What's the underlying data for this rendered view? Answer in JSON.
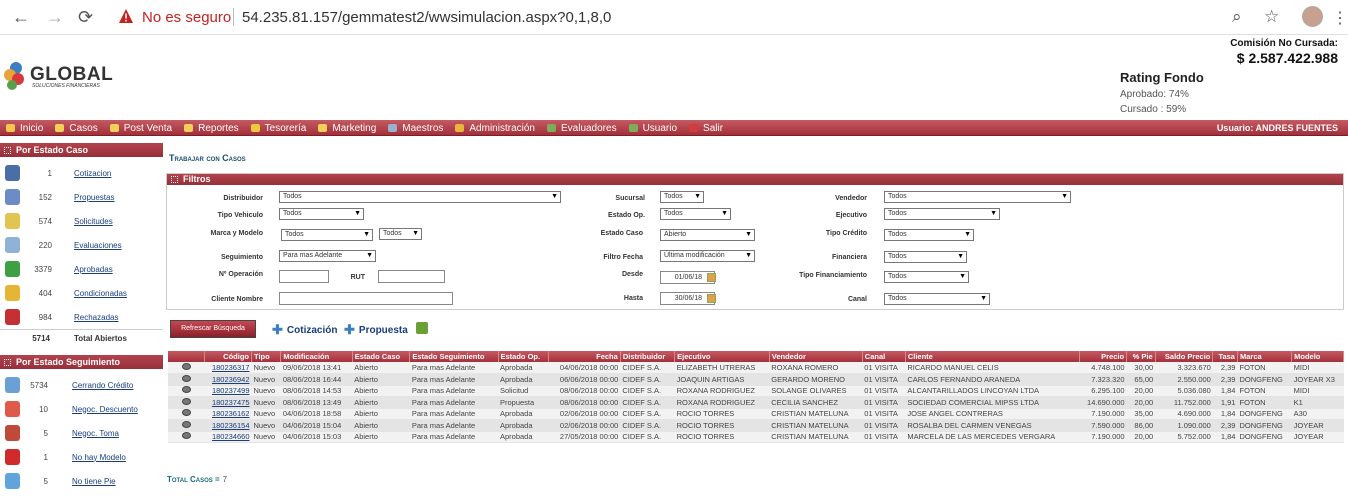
{
  "browser": {
    "back": "←",
    "forward": "→",
    "reload": "⟳",
    "security_label": "No es seguro",
    "url": "54.235.81.157/gemmatest2/wwsimulacion.aspx?0,1,8,0",
    "zoom_icon": "⌕",
    "star_icon": "☆",
    "kebab": "⋮"
  },
  "header": {
    "logo_text": "GLOBAL",
    "logo_sub": "SOLUCIONES FINANCIERAS",
    "comision_label": "Comisión No Cursada:",
    "comision_value": "$ 2.587.422.988",
    "rating_title": "Rating Fondo",
    "rating_aprobado": "Aprobado: 74%",
    "rating_cursado": "Cursado : 59%"
  },
  "menu": {
    "items": [
      {
        "label": "Inicio",
        "color": "#f3c64c"
      },
      {
        "label": "Casos",
        "color": "#f1d05a"
      },
      {
        "label": "Post Venta",
        "color": "#f1d05a"
      },
      {
        "label": "Reportes",
        "color": "#f1d05a"
      },
      {
        "label": "Tesorería",
        "color": "#ecc93d"
      },
      {
        "label": "Marketing",
        "color": "#f1d05a"
      },
      {
        "label": "Maestros",
        "color": "#9ab0cf"
      },
      {
        "label": "Administración",
        "color": "#e8b63b"
      },
      {
        "label": "Evaluadores",
        "color": "#7cae5a"
      },
      {
        "label": "Usuario",
        "color": "#7cae5a"
      },
      {
        "label": "Salir",
        "color": "#d33c3c"
      }
    ],
    "user": "Usuario:  ANDRES FUENTES"
  },
  "side_estado": {
    "title": "Por Estado Caso",
    "rows": [
      {
        "count": "1",
        "label": "Cotizacion",
        "color": "#4a6ea5"
      },
      {
        "count": "152",
        "label": "Propuestas",
        "color": "#6b8cc4"
      },
      {
        "count": "574",
        "label": "Solicitudes",
        "color": "#e1c550"
      },
      {
        "count": "220",
        "label": "Evaluaciones",
        "color": "#8eb3d6"
      },
      {
        "count": "3379",
        "label": "Aprobadas",
        "color": "#3ea044"
      },
      {
        "count": "404",
        "label": "Condicionadas",
        "color": "#e7b536"
      },
      {
        "count": "984",
        "label": "Rechazadas",
        "color": "#c53035"
      }
    ],
    "total_count": "5714",
    "total_label": "Total Abiertos"
  },
  "side_seguimiento": {
    "title": "Por Estado Seguimiento",
    "rows": [
      {
        "count": "5734",
        "label": "Cerrando Crédito",
        "color": "#6aa0d4"
      },
      {
        "count": "10",
        "label": "Negoc. Descuento",
        "color": "#e05a4a"
      },
      {
        "count": "5",
        "label": "Negoc. Toma",
        "color": "#c04a3a"
      },
      {
        "count": "1",
        "label": "No hay Modelo",
        "color": "#d02a2a"
      },
      {
        "count": "5",
        "label": "No tiene Pie",
        "color": "#5fa5dc"
      }
    ]
  },
  "main": {
    "title": "Trabajar con Casos"
  },
  "filtros": {
    "title": "Filtros",
    "distribuidor_label": "Distribuidor",
    "distribuidor": "Todos",
    "sucursal_label": "Sucursal",
    "sucursal": "Todos",
    "vendedor_label": "Vendedor",
    "vendedor": "Todos",
    "tipo_vehiculo_label": "Tipo Vehiculo",
    "tipo_vehiculo": "Todos",
    "estado_op_label": "Estado Op.",
    "estado_op": "Todos",
    "ejecutivo_label": "Ejecutivo",
    "ejecutivo": "Todos",
    "marca_modelo_label": "Marca y Modelo",
    "marca": "Todos",
    "modelo": "Todos",
    "estado_caso_label": "Estado Caso",
    "estado_caso": "Abierto",
    "tipo_credito_label": "Tipo Crédito",
    "tipo_credito": "Todos",
    "seguimiento_label": "Seguimiento",
    "seguimiento": "Para mas Adelante",
    "filtro_fecha_label": "Filtro Fecha",
    "filtro_fecha": "Última modificación",
    "financiera_label": "Financiera",
    "financiera": "Todos",
    "nro_operacion_label": "Nº Operación",
    "rut_label": "RUT",
    "desde_label": "Desde",
    "desde": "01/06/18",
    "tipo_financiamiento_label": "Tipo Financiamiento",
    "tipo_financiamiento": "Todos",
    "cliente_nombre_label": "Cliente Nombre",
    "hasta_label": "Hasta",
    "hasta": "30/06/18",
    "canal_label": "Canal",
    "canal": "Todos"
  },
  "actions": {
    "refresh": "Refrescar Búsqueda",
    "cotizacion": "Cotización",
    "propuesta": "Propuesta"
  },
  "grid": {
    "headers": [
      "Código",
      "Tipo",
      "Modificación",
      "Estado Caso",
      "Estado Seguimiento",
      "Estado Op.",
      "Fecha",
      "Distribuidor",
      "Ejecutivo",
      "Vendedor",
      "Canal",
      "Cliente",
      "Precio",
      "% Pie",
      "Saldo Precio",
      "Tasa",
      "Marca",
      "Modelo"
    ],
    "rows": [
      [
        "180236317",
        "Nuevo",
        "09/06/2018 13:41",
        "Abierto",
        "Para mas Adelante",
        "Aprobada",
        "04/06/2018 00:00",
        "CIDEF S.A.",
        "ELIZABETH UTRERAS",
        "ROXANA ROMERO",
        "01 VISITA",
        "RICARDO MANUEL CELIS",
        "4.748.100",
        "30,00",
        "3.323.670",
        "2,39",
        "FOTON",
        "MIDI"
      ],
      [
        "180236942",
        "Nuevo",
        "08/06/2018 16:44",
        "Abierto",
        "Para mas Adelante",
        "Aprobada",
        "06/06/2018 00:00",
        "CIDEF S.A.",
        "JOAQUIN ARTIGAS",
        "GERARDO MORENO",
        "01 VISITA",
        "CARLOS FERNANDO ARANEDA",
        "7.323.320",
        "65,00",
        "2.550.000",
        "2,39",
        "DONGFENG",
        "JOYEAR X3"
      ],
      [
        "180237499",
        "Nuevo",
        "08/06/2018 14:53",
        "Abierto",
        "Para mas Adelante",
        "Solicitud",
        "08/06/2018 00:00",
        "CIDEF S.A.",
        "ROXANA RODRIGUEZ",
        "SOLANGE OLIVARES",
        "01 VISITA",
        "ALCANTARILLADOS LINCOYAN LTDA",
        "6.295.100",
        "20,00",
        "5.036.080",
        "1,84",
        "FOTON",
        "MIDI"
      ],
      [
        "180237475",
        "Nuevo",
        "08/06/2018 13:49",
        "Abierto",
        "Para mas Adelante",
        "Propuesta",
        "08/06/2018 00:00",
        "CIDEF S.A.",
        "ROXANA RODRIGUEZ",
        "CECILIA SANCHEZ",
        "01 VISITA",
        "SOCIEDAD COMERCIAL MIPSS LTDA",
        "14.690.000",
        "20,00",
        "11.752.000",
        "1,91",
        "FOTON",
        "K1"
      ],
      [
        "180236162",
        "Nuevo",
        "04/06/2018 18:58",
        "Abierto",
        "Para mas Adelante",
        "Aprobada",
        "02/06/2018 00:00",
        "CIDEF S.A.",
        "ROCIO TORRES",
        "CRISTIAN MATELUNA",
        "01 VISITA",
        "JOSE ANGEL CONTRERAS",
        "7.190.000",
        "35,00",
        "4.690.000",
        "1,84",
        "DONGFENG",
        "A30"
      ],
      [
        "180236154",
        "Nuevo",
        "04/06/2018 15:04",
        "Abierto",
        "Para mas Adelante",
        "Aprobada",
        "02/06/2018 00:00",
        "CIDEF S.A.",
        "ROCIO TORRES",
        "CRISTIAN MATELUNA",
        "01 VISITA",
        "ROSALBA DEL CARMEN VENEGAS",
        "7.590.000",
        "86,00",
        "1.090.000",
        "2,39",
        "DONGFENG",
        "JOYEAR"
      ],
      [
        "180234660",
        "Nuevo",
        "04/06/2018 15:03",
        "Abierto",
        "Para mas Adelante",
        "Aprobada",
        "27/05/2018 00:00",
        "CIDEF S.A.",
        "ROCIO TORRES",
        "CRISTIAN MATELUNA",
        "01 VISITA",
        "MARCELA DE LAS MERCEDES VERGARA",
        "7.190.000",
        "20,00",
        "5.752.000",
        "1,84",
        "DONGFENG",
        "JOYEAR"
      ]
    ],
    "total_label": "Total Casos =",
    "total_value": "7"
  }
}
